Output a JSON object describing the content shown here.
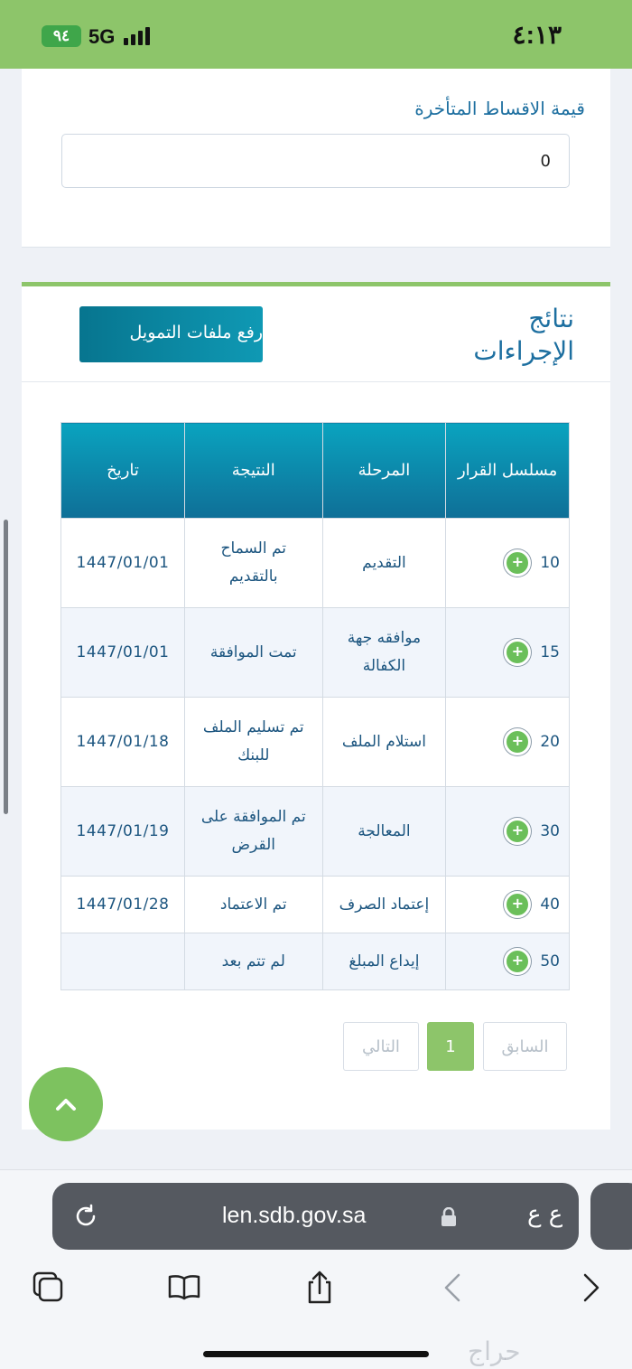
{
  "status_bar": {
    "time": "٤:١٣",
    "network": "5G",
    "battery": "٩٤"
  },
  "late_installments": {
    "label": "قيمة الاقساط المتأخرة",
    "value": "0"
  },
  "procedures": {
    "title": "نتائج الإجراءات",
    "upload_button": "رفع ملفات التمويل",
    "columns": [
      "مسلسل القرار",
      "المرحلة",
      "النتيجة",
      "تاريخ"
    ],
    "rows": [
      {
        "serial": "10",
        "stage": "التقديم",
        "result": "تم السماح بالتقديم",
        "date": "1447/01/01"
      },
      {
        "serial": "15",
        "stage": "موافقه جهة الكفالة",
        "result": "تمت الموافقة",
        "date": "1447/01/01"
      },
      {
        "serial": "20",
        "stage": "استلام الملف",
        "result": "تم تسليم الملف للبنك",
        "date": "1447/01/18"
      },
      {
        "serial": "30",
        "stage": "المعالجة",
        "result": "تم الموافقة على القرض",
        "date": "1447/01/19"
      },
      {
        "serial": "40",
        "stage": "إعتماد الصرف",
        "result": "تم الاعتماد",
        "date": "1447/01/28"
      },
      {
        "serial": "50",
        "stage": "إيداع المبلغ",
        "result": "لم تتم بعد",
        "date": ""
      }
    ],
    "pagination": {
      "prev": "السابق",
      "current": "1",
      "next": "التالي"
    }
  },
  "browser": {
    "url": "len.sdb.gov.sa",
    "text_size_label": "ع ع"
  },
  "watermark": "حراج"
}
